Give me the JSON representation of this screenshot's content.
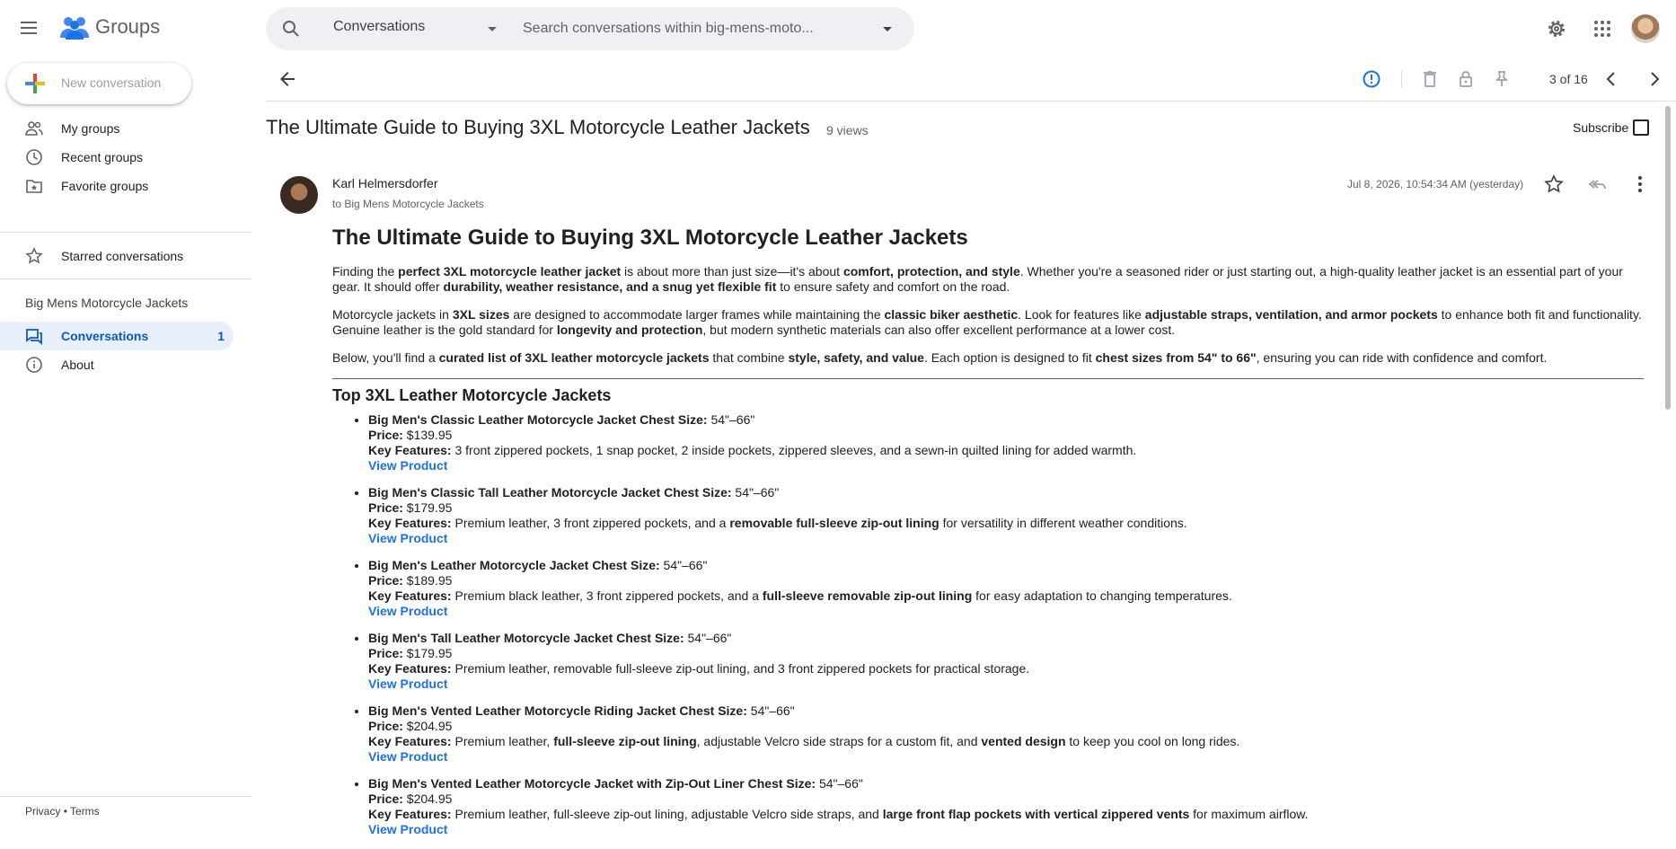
{
  "app": {
    "name": "Groups"
  },
  "search": {
    "scope": "Conversations",
    "placeholder": "Search conversations within big-mens-moto..."
  },
  "sidebar": {
    "new_conversation": "New conversation",
    "items": [
      {
        "label": "My groups",
        "icon": "people-icon"
      },
      {
        "label": "Recent groups",
        "icon": "clock-icon"
      },
      {
        "label": "Favorite groups",
        "icon": "folder-star-icon"
      },
      {
        "label": "Starred conversations",
        "icon": "star-icon"
      }
    ],
    "group_name": "Big Mens Motorcycle Jackets",
    "group_items": [
      {
        "label": "Conversations",
        "count": "1",
        "active": true
      },
      {
        "label": "About"
      }
    ],
    "footer": {
      "privacy": "Privacy",
      "sep": "•",
      "terms": "Terms"
    }
  },
  "toolbar": {
    "pager": "3 of 16"
  },
  "conversation": {
    "title": "The Ultimate Guide to Buying 3XL Motorcycle Leather Jackets",
    "views": "9 views",
    "subscribe": "Subscribe"
  },
  "post": {
    "author": "Karl Helmersdorfer",
    "to": "to Big Mens Motorcycle Jackets",
    "date": "Jul 8, 2026, 10:54:34 AM (yesterday)",
    "heading": "The Ultimate Guide to Buying 3XL Motorcycle Leather Jackets",
    "p1": [
      {
        "t": "Finding the "
      },
      {
        "b": "perfect 3XL motorcycle leather jacket"
      },
      {
        "t": " is about more than just size—it's about "
      },
      {
        "b": "comfort, protection, and style"
      },
      {
        "t": ". Whether you're a seasoned rider or just starting out, a high-quality leather jacket is an essential part of your gear. It should offer "
      },
      {
        "b": "durability, weather resistance, and a snug yet flexible fit"
      },
      {
        "t": " to ensure safety and comfort on the road."
      }
    ],
    "p2": [
      {
        "t": "Motorcycle jackets in "
      },
      {
        "b": "3XL sizes"
      },
      {
        "t": " are designed to accommodate larger frames while maintaining the "
      },
      {
        "b": "classic biker aesthetic"
      },
      {
        "t": ". Look for features like "
      },
      {
        "b": "adjustable straps, ventilation, and armor pockets"
      },
      {
        "t": " to enhance both fit and functionality. Genuine leather is the gold standard for "
      },
      {
        "b": "longevity and protection"
      },
      {
        "t": ", but modern synthetic materials can also offer excellent performance at a lower cost."
      }
    ],
    "p3": [
      {
        "t": "Below, you'll find a "
      },
      {
        "b": "curated list of 3XL leather motorcycle jackets"
      },
      {
        "t": " that combine "
      },
      {
        "b": "style, safety, and value"
      },
      {
        "t": ". Each option is designed to fit "
      },
      {
        "b": "chest sizes from 54\" to 66\""
      },
      {
        "t": ", ensuring you can ride with confidence and comfort."
      }
    ],
    "list_heading": "Top 3XL Leather Motorcycle Jackets",
    "price_label": "Price:",
    "features_label": "Key Features:",
    "link_label": "View Product",
    "products": [
      {
        "name": "Big Men's Classic Leather Motorcycle Jacket Chest Size:",
        "size": " 54\"–66\"",
        "price": " $139.95",
        "features": [
          {
            "t": " 3 front zippered pockets, 1 snap pocket, 2 inside pockets, zippered sleeves, and a sewn-in quilted lining for added warmth."
          }
        ]
      },
      {
        "name": "Big Men's Classic Tall Leather Motorcycle Jacket Chest Size:",
        "size": " 54\"–66\"",
        "price": " $179.95",
        "features": [
          {
            "t": " Premium leather, 3 front zippered pockets, and a "
          },
          {
            "b": "removable full-sleeve zip-out lining"
          },
          {
            "t": " for versatility in different weather conditions."
          }
        ]
      },
      {
        "name": "Big Men's Leather Motorcycle Jacket Chest Size:",
        "size": " 54\"–66\"",
        "price": " $189.95",
        "features": [
          {
            "t": " Premium black leather, 3 front zippered pockets, and a "
          },
          {
            "b": "full-sleeve removable zip-out lining"
          },
          {
            "t": " for easy adaptation to changing temperatures."
          }
        ]
      },
      {
        "name": "Big Men's Tall Leather Motorcycle Jacket Chest Size:",
        "size": " 54\"–66\"",
        "price": " $179.95",
        "features": [
          {
            "t": " Premium leather, removable full-sleeve zip-out lining, and 3 front zippered pockets for practical storage."
          }
        ]
      },
      {
        "name": "Big Men's Vented Leather Motorcycle Riding Jacket Chest Size:",
        "size": " 54\"–66\"",
        "price": " $204.95",
        "features": [
          {
            "t": " Premium leather, "
          },
          {
            "b": "full-sleeve zip-out lining"
          },
          {
            "t": ", adjustable Velcro side straps for a custom fit, and "
          },
          {
            "b": "vented design"
          },
          {
            "t": " to keep you cool on long rides."
          }
        ]
      },
      {
        "name": "Big Men's Vented Leather Motorcycle Jacket with Zip-Out Liner Chest Size:",
        "size": " 54\"–66\"",
        "price": " $204.95",
        "features": [
          {
            "t": " Premium leather, full-sleeve zip-out lining, adjustable Velcro side straps, and "
          },
          {
            "b": "large front flap pockets with vertical zippered vents"
          },
          {
            "t": " for maximum airflow."
          }
        ]
      }
    ]
  },
  "colors": {
    "accent": "#0b57d0",
    "link": "#1a73e8",
    "active_bg": "#e8f0fe",
    "search_bg": "#eef0f3"
  }
}
